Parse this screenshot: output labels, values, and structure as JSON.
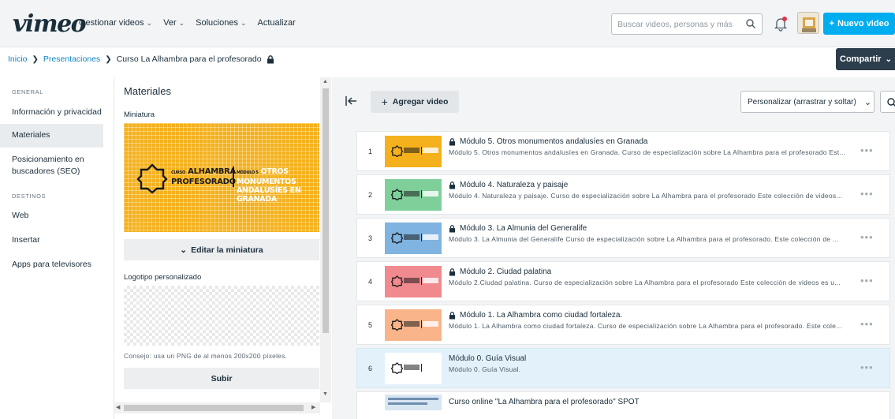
{
  "nav": {
    "logo": "vimeo",
    "links": [
      "Gestionar videos",
      "Ver",
      "Soluciones",
      "Actualizar"
    ],
    "search_placeholder": "Buscar videos, personas y más",
    "new_video": "Nuevo video"
  },
  "breadcrumb": {
    "home": "Inicio",
    "parent": "Presentaciones",
    "current": "Curso La Alhambra para el profesorado"
  },
  "share_label": "Compartir",
  "leftnav": {
    "section_general": "GENERAL",
    "items_general": [
      "Información y privacidad",
      "Materiales",
      "Posicionamiento en buscadores (SEO)"
    ],
    "section_destinos": "DESTINOS",
    "items_destinos": [
      "Web",
      "Insertar",
      "Apps para televisores"
    ]
  },
  "materials": {
    "title": "Materiales",
    "thumbnail_label": "Miniatura",
    "thumb_text_line1": "ALHAMBRA",
    "thumb_text_line2": "PROFESORADO",
    "thumb_text_small": "CURSO",
    "thumb_text_right1": "OTROS MONUMENTOS",
    "thumb_text_right2": "ANDALUSÍES EN GRANADA",
    "thumb_text_right_small": "MÓDULO 5",
    "edit_thumbnail": "Editar la miniatura",
    "logo_label": "Logotipo personalizado",
    "tip": "Consejo: usa un PNG de al menos 200x200 píxeles.",
    "upload": "Subir"
  },
  "toolbar": {
    "add_video": "Agregar video",
    "sort": "Personalizar (arrastrar y soltar)"
  },
  "videos": [
    {
      "num": "1",
      "title": "Módulo 5. Otros monumentos andalusíes en Granada",
      "desc": "Módulo 5. Otros monumentos andalusíes en Granada. Curso de especialización sobre La Alhambra para el profesorado Est...",
      "color": "#f4b11c",
      "locked": true
    },
    {
      "num": "2",
      "title": "Módulo 4. Naturaleza y paisaje",
      "desc": "Módulo 4. Naturaleza y paisaje. Curso de especialización sobre La Alhambra para el profesorado Este colección de videos...",
      "color": "#7fcf9a",
      "locked": true
    },
    {
      "num": "3",
      "title": "Módulo 3. La Almunia del Generalife",
      "desc": "Módulo 3. La Almunia del Generalife Curso de especialización sobre La Alhambra para el profesorado. Este colección de ...",
      "color": "#7fb3e0",
      "locked": true
    },
    {
      "num": "4",
      "title": "Módulo 2. Ciudad palatina",
      "desc": "Módulo 2.Ciudad palatina. Curso de especialización sobre La Alhambra para el profesorado Este colección de videos es u...",
      "color": "#f08a8e",
      "locked": true
    },
    {
      "num": "5",
      "title": "Módulo 1. La Alhambra como ciudad fortaleza.",
      "desc": "Módulo 1. La Alhambra como ciudad fortaleza. Curso de especialización sobre La Alhambra para el profesorado. Este cole...",
      "color": "#f9b48a",
      "locked": true
    },
    {
      "num": "6",
      "title": "Módulo 0. Guía Visual",
      "desc": "Módulo 0. Guía Visual.",
      "color": "#ffffff",
      "locked": false
    },
    {
      "num": "",
      "title": "Curso online \"La Alhambra para el profesorado\" SPOT",
      "desc": "",
      "color": "#d8e6f2",
      "locked": false
    }
  ]
}
